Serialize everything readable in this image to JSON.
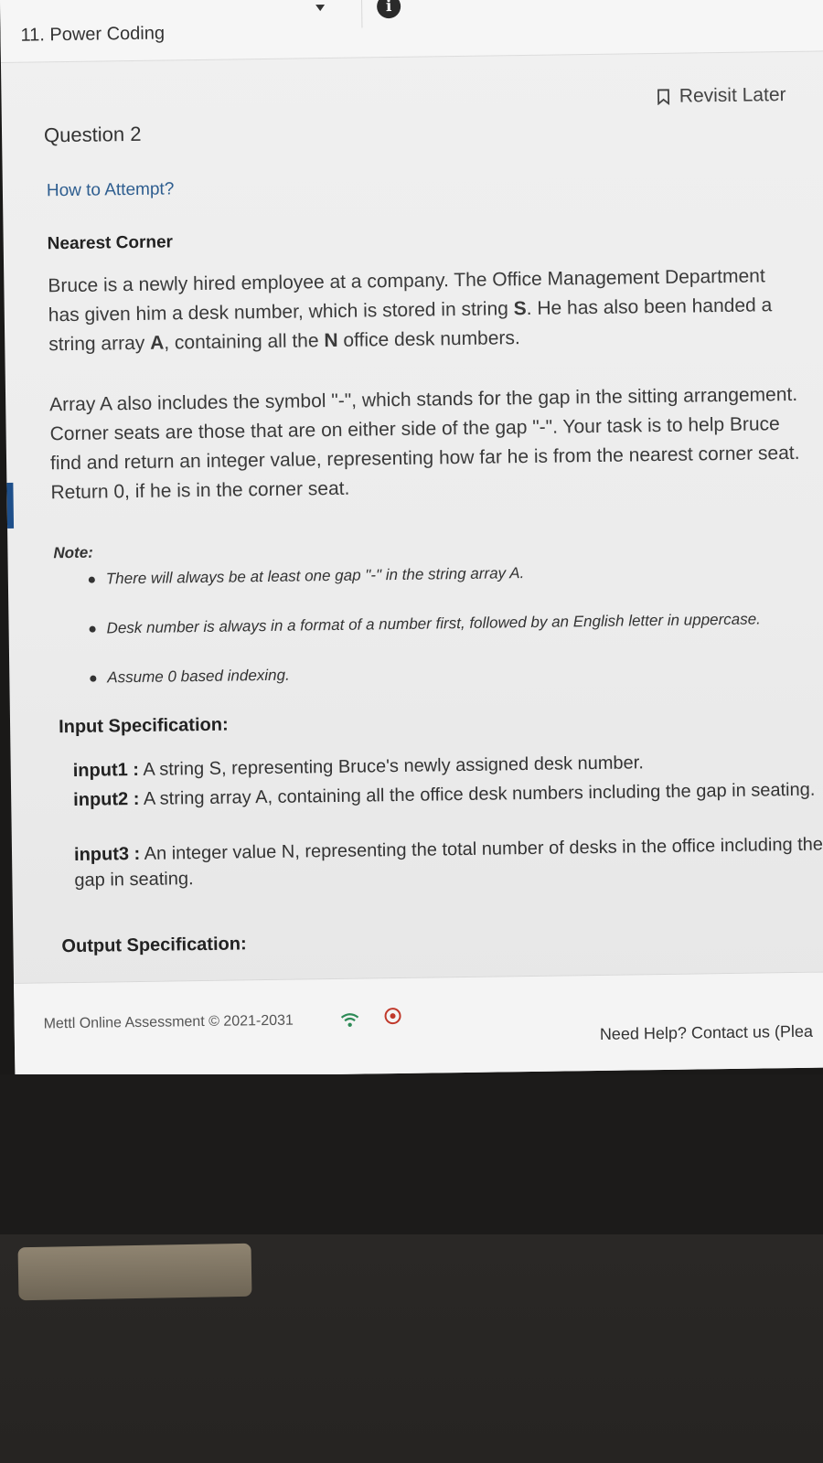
{
  "header": {
    "module_title": "11. Power Coding"
  },
  "question": {
    "title": "Question 2",
    "revisit_label": "Revisit Later",
    "how_to_attempt": "How to Attempt?",
    "problem_name": "Nearest Corner",
    "paragraph1": "Bruce is a newly hired employee at a company. The Office Management Department has given him a desk number, which is stored in string S. He has also been handed a string array A, containing all the N office desk numbers.",
    "paragraph2": "Array A also includes the symbol \"-\", which stands for the gap in the sitting arrangement. Corner seats are those that are on either side of the gap \"-\". Your task is to help Bruce find and return an integer value, representing how far he is from the nearest corner seat. Return 0, if he is in the corner seat.",
    "note_label": "Note:",
    "notes": [
      "There will always be at least one gap \"-\" in the string array A.",
      "Desk number is always in a format of a number first, followed by an English letter in uppercase.",
      "Assume 0 based indexing."
    ],
    "input_spec_title": "Input Specification:",
    "inputs": [
      {
        "label": "input1 :",
        "text": "A string S, representing Bruce's newly assigned desk number."
      },
      {
        "label": "input2 :",
        "text": "A string array A, containing all the office desk numbers including the gap in seating."
      },
      {
        "label": "input3 :",
        "text": "An integer value N, representing the total number of desks in the office including the gap in seating."
      }
    ],
    "output_spec_title": "Output Specification:"
  },
  "footer": {
    "copyright": "Mettl Online Assessment © 2021-2031",
    "help": "Need Help? Contact us (Plea"
  },
  "icons": {
    "info": "info-icon",
    "bookmark": "bookmark-icon",
    "wifi": "wifi-icon",
    "record": "record-icon",
    "caret": "chevron-down-icon"
  },
  "colors": {
    "link": "#2d5d8f",
    "record": "#c0392b",
    "wifi": "#2e8b57"
  }
}
